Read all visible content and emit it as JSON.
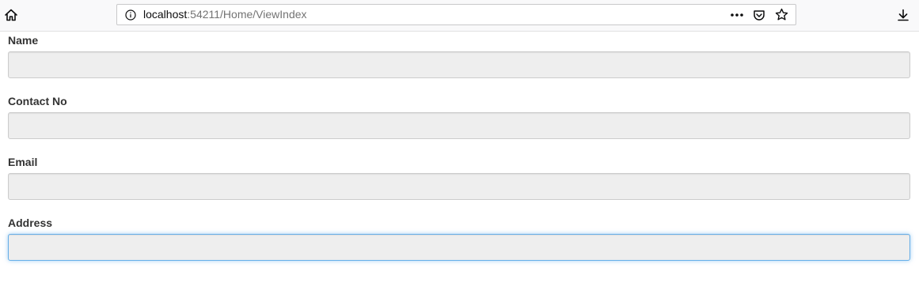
{
  "browser": {
    "url_host": "localhost",
    "url_rest": ":54211/Home/ViewIndex",
    "icons": {
      "home": "home-icon",
      "info": "info-icon",
      "more": "more-actions-icon",
      "pocket": "pocket-icon",
      "bookmark": "star-icon",
      "download": "download-icon"
    }
  },
  "form": {
    "fields": [
      {
        "label": "Name",
        "value": "",
        "placeholder": ""
      },
      {
        "label": "Contact No",
        "value": "",
        "placeholder": ""
      },
      {
        "label": "Email",
        "value": "",
        "placeholder": ""
      },
      {
        "label": "Address",
        "value": "",
        "placeholder": ""
      }
    ]
  },
  "colors": {
    "label_text": "#333333",
    "input_bg": "#eeeeee",
    "input_border": "#cccccc",
    "focus_border": "#66afe9"
  }
}
